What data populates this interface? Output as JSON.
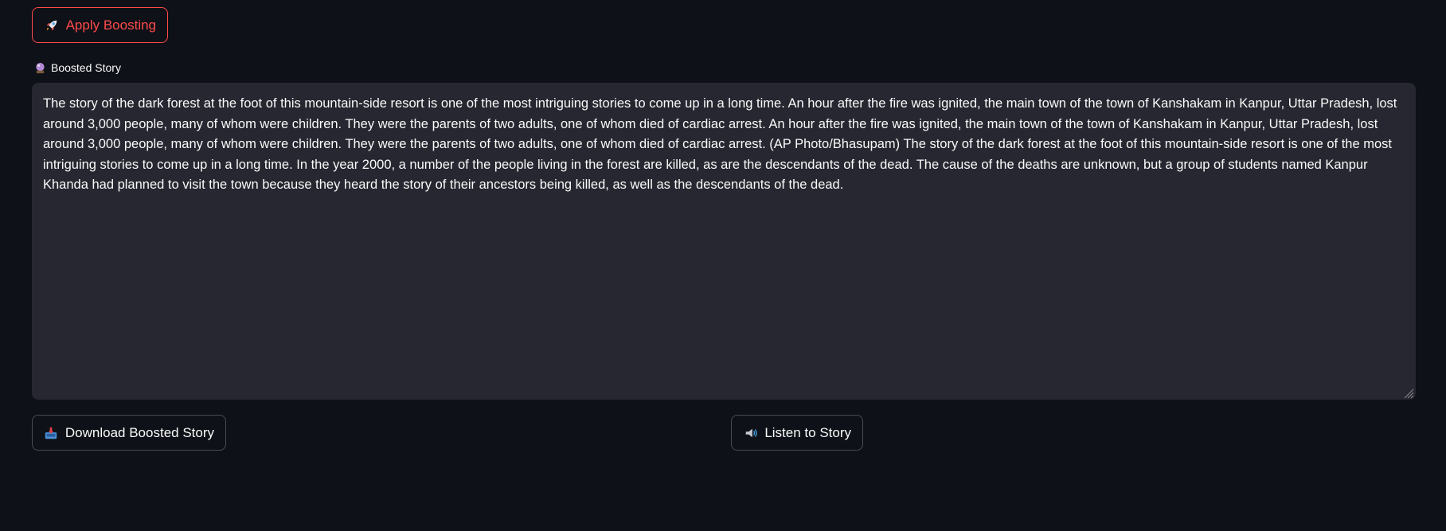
{
  "apply_button": {
    "icon": "rocket-icon",
    "label": "Apply Boosting"
  },
  "story_field": {
    "icon": "crystal-ball-icon",
    "label": "Boosted Story",
    "value": "The story of the dark forest at the foot of this mountain-side resort is one of the most intriguing stories to come up in a long time. An hour after the fire was ignited, the main town of the town of Kanshakam in Kanpur, Uttar Pradesh, lost around 3,000 people, many of whom were children. They were the parents of two adults, one of whom died of cardiac arrest. An hour after the fire was ignited, the main town of the town of Kanshakam in Kanpur, Uttar Pradesh, lost around 3,000 people, many of whom were children. They were the parents of two adults, one of whom died of cardiac arrest. (AP Photo/Bhasupam) The story of the dark forest at the foot of this mountain-side resort is one of the most intriguing stories to come up in a long time. In the year 2000, a number of the people living in the forest are killed, as are the descendants of the dead. The cause of the deaths are unknown, but a group of students named Kanpur Khanda had planned to visit the town because they heard the story of their ancestors being killed, as well as the descendants of the dead."
  },
  "download_button": {
    "icon": "inbox-tray-icon",
    "label": "Download Boosted Story"
  },
  "listen_button": {
    "icon": "speaker-icon",
    "label": "Listen to Story"
  },
  "colors": {
    "background": "#0e1117",
    "field_background": "#262730",
    "accent": "#ff4b4b",
    "text": "#fafafa"
  }
}
